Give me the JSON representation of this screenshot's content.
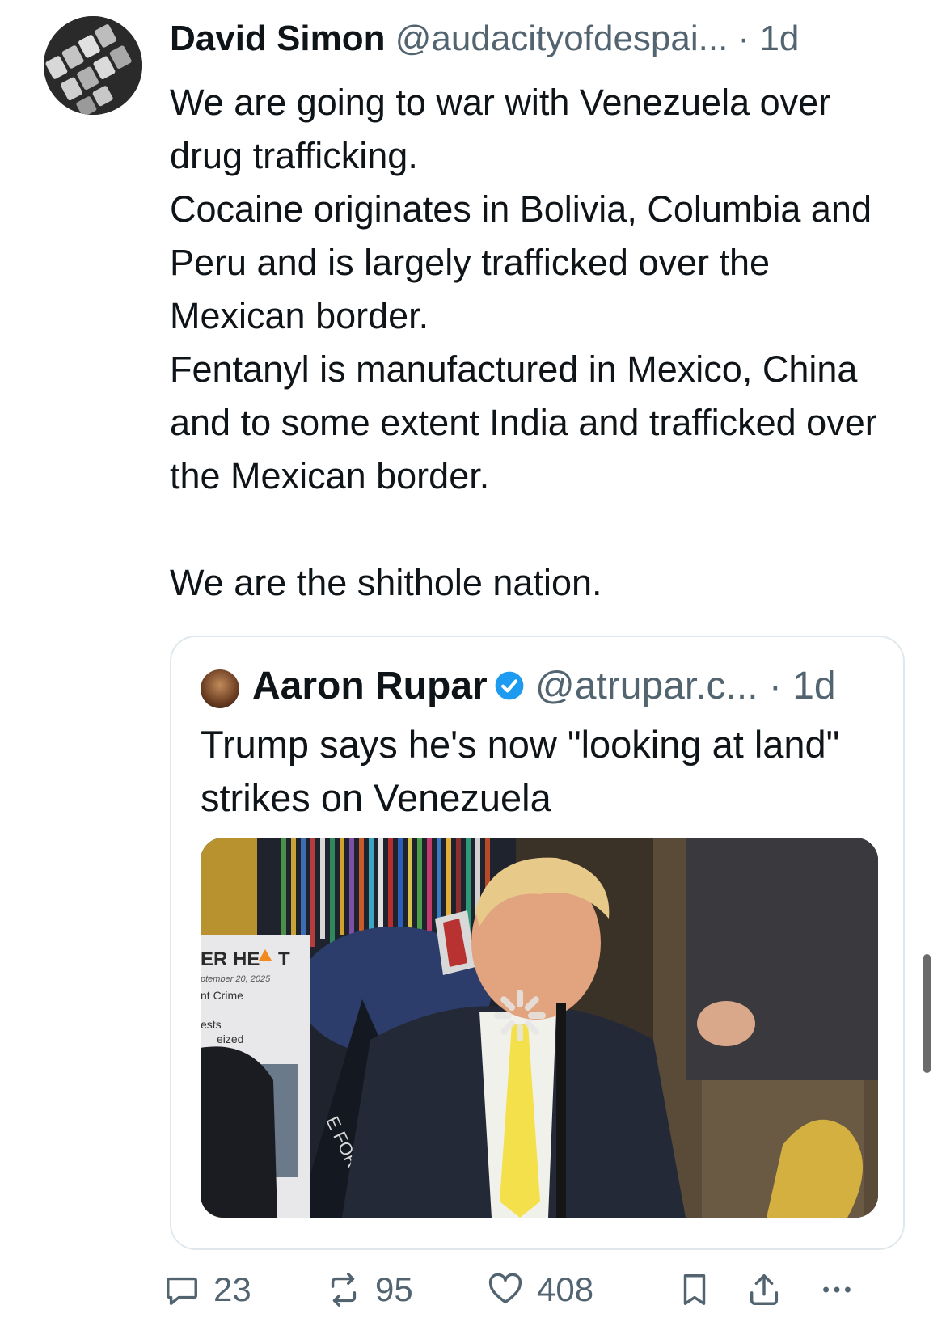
{
  "author": {
    "name": "David Simon",
    "handle": "@audacityofdespai...",
    "dot": "·",
    "time": "1d"
  },
  "tweet": {
    "lines": [
      "We are going to war with Venezuela over drug trafficking.",
      "Cocaine originates in Bolivia, Columbia and Peru and is largely trafficked over the Mexican border.",
      "Fentanyl is manufactured in Mexico, China and to some extent India and trafficked over the Mexican border."
    ],
    "closing": "We are the shithole nation."
  },
  "quote": {
    "name": "Aaron Rupar",
    "handle": "@atrupar.c...",
    "dot": "·",
    "time": "1d",
    "text": "Trump says he's now \"looking at land\" strikes on Venezuela",
    "media": {
      "sign_line1": "ER HE",
      "sign_line1b": "T",
      "sign_date": "ptember 20, 2025",
      "sign_line2": "nt Crime",
      "sign_line3": "ests",
      "sign_line4": "eized",
      "seal_text": "E FOR"
    }
  },
  "actions": {
    "replies": "23",
    "reposts": "95",
    "likes": "408"
  },
  "colors": {
    "text": "#0f1419",
    "secondary": "#536471",
    "verified": "#1d9bf0",
    "border": "#e1e8ed"
  }
}
